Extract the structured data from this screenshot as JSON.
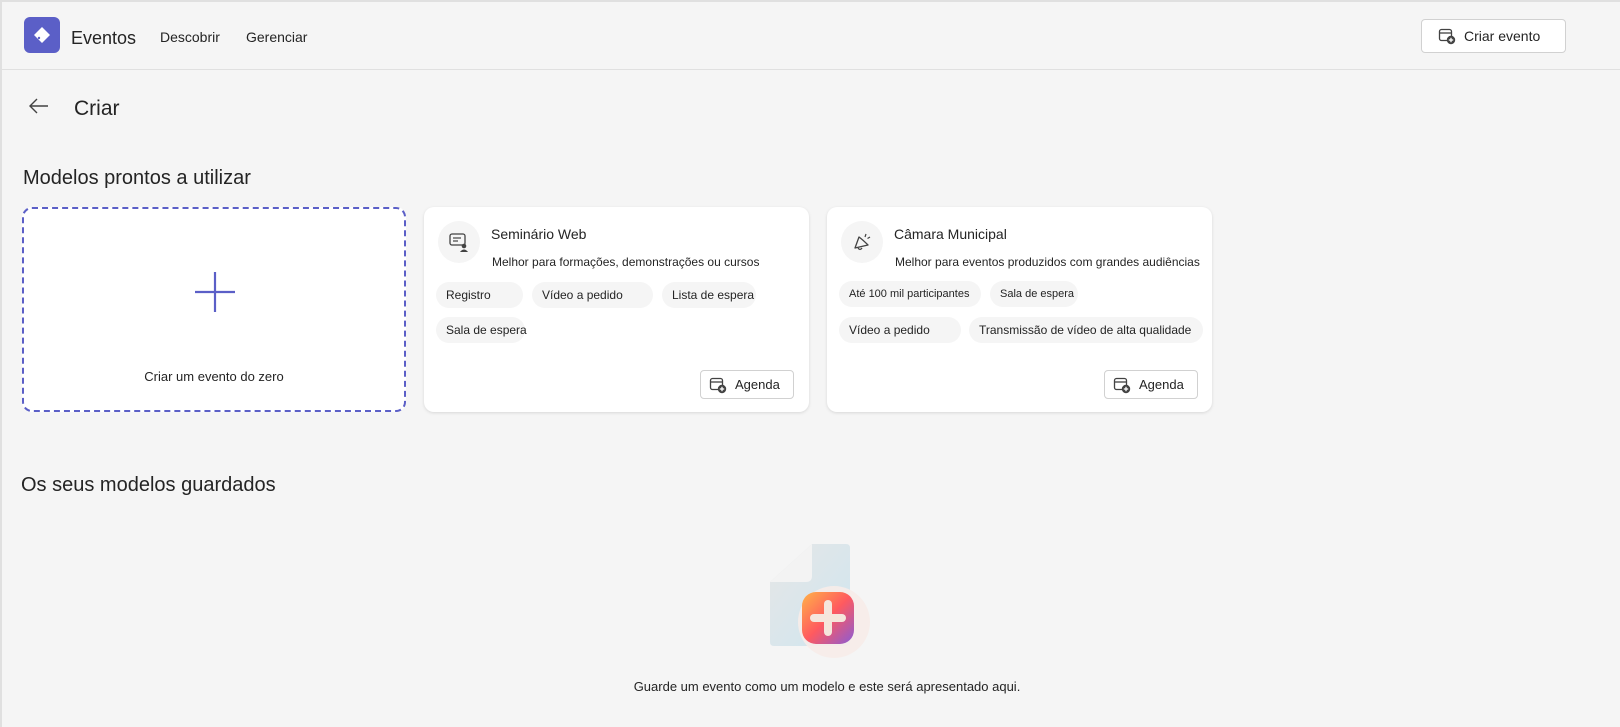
{
  "header": {
    "app_title": "Eventos",
    "nav": [
      {
        "label": "Descobrir"
      },
      {
        "label": "Gerenciar"
      }
    ],
    "create_event_label": "Criar evento"
  },
  "page": {
    "title": "Criar"
  },
  "ready_templates": {
    "section_title": "Modelos prontos a utilizar",
    "blank": {
      "label": "Criar um evento do zero"
    },
    "cards": [
      {
        "title": "Seminário Web",
        "description": "Melhor para formações, demonstrações ou cursos",
        "chips": [
          "Registro",
          "Vídeo a pedido",
          "Lista de espera",
          "Sala de espera"
        ],
        "action_label": "Agenda",
        "icon": "webinar-icon"
      },
      {
        "title": "Câmara Municipal",
        "description": "Melhor para eventos produzidos com grandes audiências",
        "chips": [
          "Até 100 mil participantes",
          "Sala de espera",
          "Vídeo a pedido",
          "Transmissão de vídeo de alta qualidade"
        ],
        "action_label": "Agenda",
        "icon": "megaphone-icon"
      }
    ]
  },
  "saved_templates": {
    "section_title": "Os seus modelos guardados",
    "empty_message": "Guarde um evento como um modelo e este será apresentado aqui."
  },
  "colors": {
    "accent": "#5b5fc7",
    "background": "#f5f5f5",
    "card": "#ffffff"
  }
}
